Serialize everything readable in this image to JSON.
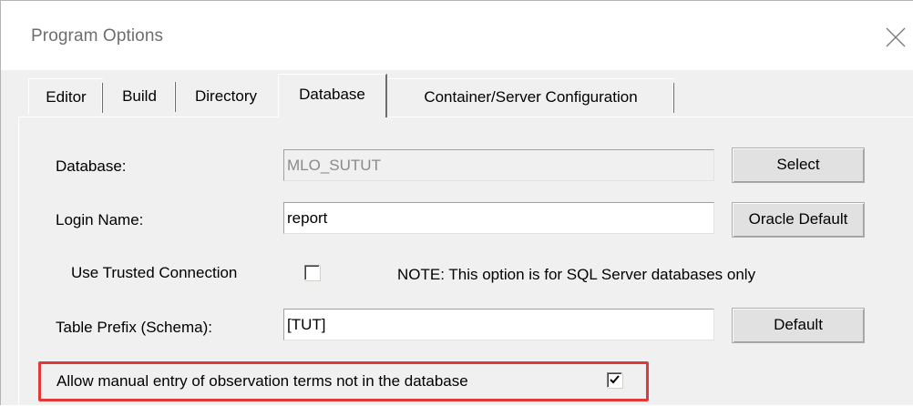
{
  "window": {
    "title": "Program Options"
  },
  "tabs": [
    {
      "label": "Editor",
      "active": false
    },
    {
      "label": "Build",
      "active": false
    },
    {
      "label": "Directory",
      "active": false
    },
    {
      "label": "Database",
      "active": true
    },
    {
      "label": "Container/Server Configuration",
      "active": false
    }
  ],
  "database": {
    "label": "Database:",
    "value": "MLO_SUTUT",
    "button": "Select"
  },
  "login": {
    "label": "Login Name:",
    "value": "report",
    "button": "Oracle Default"
  },
  "trusted": {
    "label": "Use Trusted Connection",
    "checked": false,
    "note": "NOTE: This option is for SQL Server databases only"
  },
  "prefix": {
    "label": "Table Prefix (Schema):",
    "value": "[TUT]",
    "button": "Default"
  },
  "manual_entry": {
    "label": "Allow manual entry of observation terms not in the database",
    "checked": true
  },
  "colors": {
    "highlight": "#e0393a",
    "background": "#f0f0f0"
  },
  "icons": {
    "close": "close-icon",
    "check": "checkmark-icon"
  }
}
